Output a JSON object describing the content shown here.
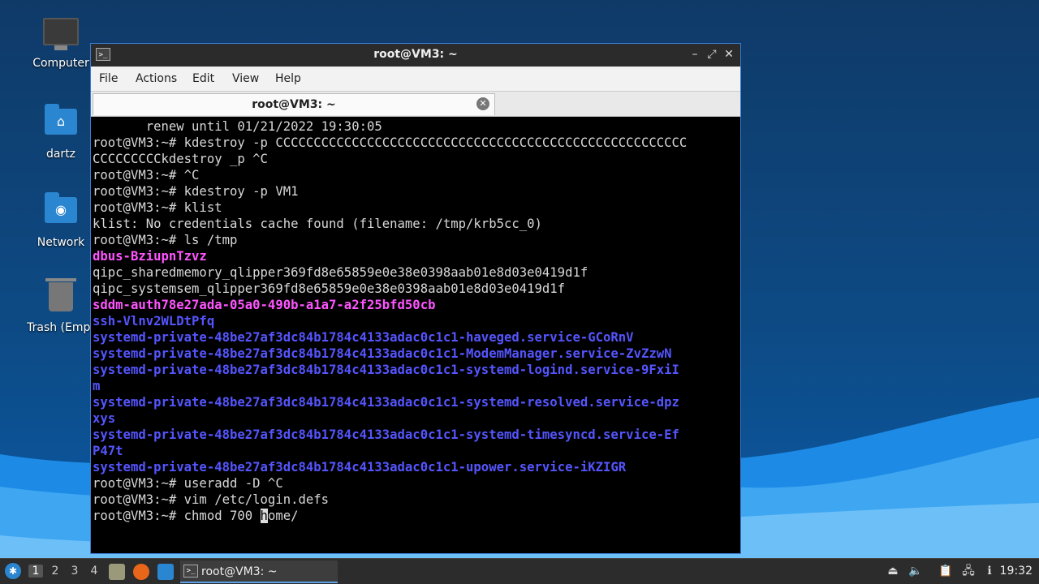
{
  "desktop": {
    "icons": [
      {
        "label": "Computer",
        "icon": "computer-icon"
      },
      {
        "label": "dartz",
        "icon": "home-folder-icon"
      },
      {
        "label": "Network",
        "icon": "network-folder-icon"
      },
      {
        "label": "Trash (Empt",
        "icon": "trash-icon"
      }
    ]
  },
  "window": {
    "title": "root@VM3: ~",
    "controls": {
      "minimize": "–",
      "maximize": "⤢",
      "close": "✕"
    },
    "menu": [
      "File",
      "Actions",
      "Edit",
      "View",
      "Help"
    ],
    "tab": {
      "label": "root@VM3: ~",
      "close": "✕"
    },
    "terminal_lines": [
      {
        "text": "       renew until 01/21/2022 19:30:05",
        "style": "plain"
      },
      {
        "text": "root@VM3:~# kdestroy -p CCCCCCCCCCCCCCCCCCCCCCCCCCCCCCCCCCCCCCCCCCCCCCCCCCCCCC",
        "style": "plain"
      },
      {
        "text": "CCCCCCCCCkdestroy _p ^C",
        "style": "plain"
      },
      {
        "text": "root@VM3:~# ^C",
        "style": "plain"
      },
      {
        "text": "root@VM3:~# kdestroy -p VM1",
        "style": "plain"
      },
      {
        "text": "root@VM3:~# klist",
        "style": "plain"
      },
      {
        "text": "klist: No credentials cache found (filename: /tmp/krb5cc_0)",
        "style": "plain"
      },
      {
        "text": "root@VM3:~# ls /tmp",
        "style": "plain"
      },
      {
        "text": "dbus-BziupnTzvz",
        "style": "pink"
      },
      {
        "text": "qipc_sharedmemory_qlipper369fd8e65859e0e38e0398aab01e8d03e0419d1f",
        "style": "plain"
      },
      {
        "text": "qipc_systemsem_qlipper369fd8e65859e0e38e0398aab01e8d03e0419d1f",
        "style": "plain"
      },
      {
        "text": "sddm-auth78e27ada-05a0-490b-a1a7-a2f25bfd50cb",
        "style": "pink"
      },
      {
        "text": "ssh-Vlnv2WLDtPfq",
        "style": "blue"
      },
      {
        "text": "systemd-private-48be27af3dc84b1784c4133adac0c1c1-haveged.service-GCoRnV",
        "style": "blue"
      },
      {
        "text": "systemd-private-48be27af3dc84b1784c4133adac0c1c1-ModemManager.service-ZvZzwN",
        "style": "blue"
      },
      {
        "text": "systemd-private-48be27af3dc84b1784c4133adac0c1c1-systemd-logind.service-9FxiI",
        "style": "blue"
      },
      {
        "text": "m",
        "style": "blue"
      },
      {
        "text": "systemd-private-48be27af3dc84b1784c4133adac0c1c1-systemd-resolved.service-dpz",
        "style": "blue"
      },
      {
        "text": "xys",
        "style": "blue"
      },
      {
        "text": "systemd-private-48be27af3dc84b1784c4133adac0c1c1-systemd-timesyncd.service-Ef",
        "style": "blue"
      },
      {
        "text": "P47t",
        "style": "blue"
      },
      {
        "text": "systemd-private-48be27af3dc84b1784c4133adac0c1c1-upower.service-iKZIGR",
        "style": "blue"
      },
      {
        "text": "root@VM3:~# useradd -D ^C",
        "style": "plain"
      },
      {
        "text": "root@VM3:~# vim /etc/login.defs",
        "style": "plain"
      }
    ],
    "prompt_line": {
      "before_cursor": "root@VM3:~# chmod 700 ",
      "cursor_char": "h",
      "after_cursor": "ome/"
    }
  },
  "taskbar": {
    "workspaces": [
      "1",
      "2",
      "3",
      "4"
    ],
    "active_workspace": "1",
    "launchers": [
      "file-manager-icon",
      "firefox-icon",
      "desktop-icon"
    ],
    "task_label": "root@VM3: ~",
    "tray_icons": [
      "eject-icon",
      "volume-icon",
      "clipboard-icon",
      "network-icon",
      "info-icon"
    ],
    "clock": "19:32"
  },
  "colors": {
    "window_border": "#3b7bd0",
    "terminal_bg": "#000000",
    "terminal_fg": "#d8d8d8",
    "dir_pink": "#ff55ff",
    "dir_blue": "#5555ff"
  }
}
